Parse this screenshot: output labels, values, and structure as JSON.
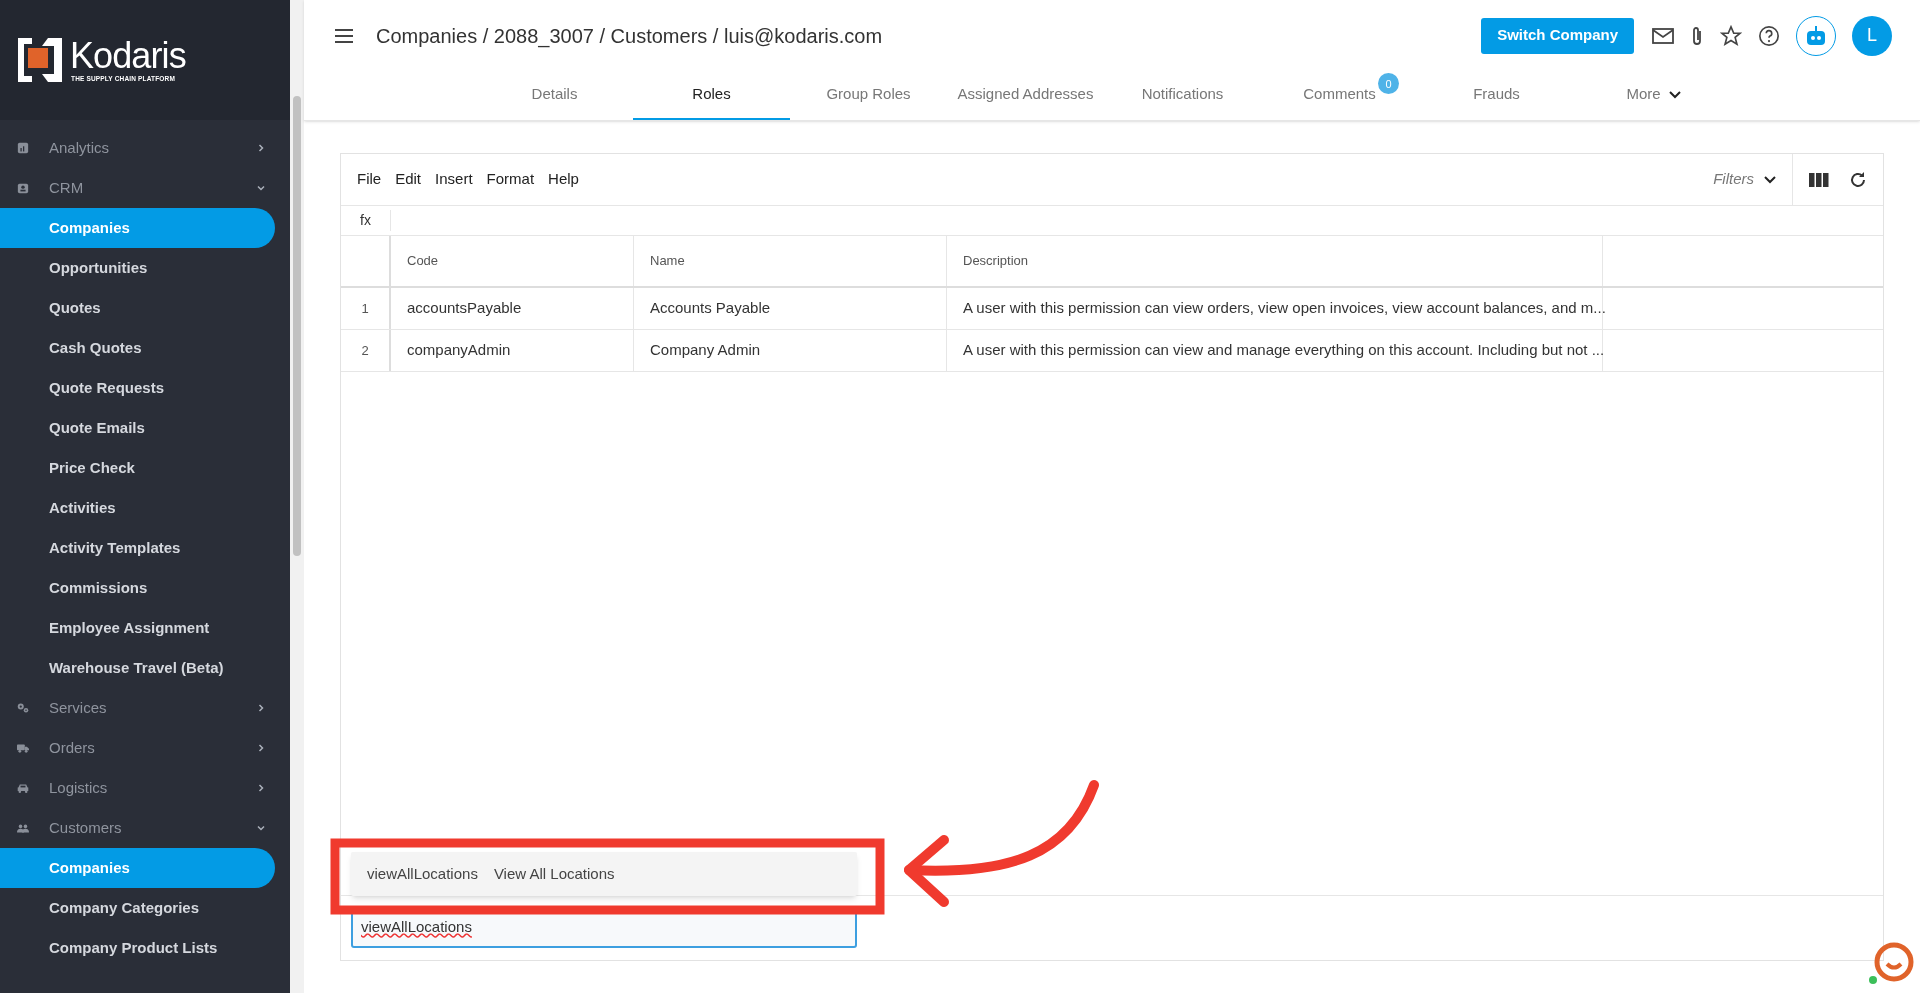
{
  "brand": {
    "name": "Kodaris",
    "tagline": "THE SUPPLY CHAIN PLATFORM"
  },
  "sidebar": {
    "items": [
      {
        "label": "Analytics",
        "expanded": false
      },
      {
        "label": "CRM",
        "expanded": true,
        "children": [
          {
            "label": "Companies",
            "selected": true
          },
          {
            "label": "Opportunities",
            "selected": false
          },
          {
            "label": "Quotes",
            "selected": false
          },
          {
            "label": "Cash Quotes",
            "selected": false
          },
          {
            "label": "Quote Requests",
            "selected": false
          },
          {
            "label": "Quote Emails",
            "selected": false
          },
          {
            "label": "Price Check",
            "selected": false
          },
          {
            "label": "Activities",
            "selected": false
          },
          {
            "label": "Activity Templates",
            "selected": false
          },
          {
            "label": "Commissions",
            "selected": false
          },
          {
            "label": "Employee Assignment",
            "selected": false
          },
          {
            "label": "Warehouse Travel (Beta)",
            "selected": false
          }
        ]
      },
      {
        "label": "Services",
        "expanded": false
      },
      {
        "label": "Orders",
        "expanded": false
      },
      {
        "label": "Logistics",
        "expanded": false
      },
      {
        "label": "Customers",
        "expanded": true,
        "children": [
          {
            "label": "Companies",
            "selected": true
          },
          {
            "label": "Company Categories",
            "selected": false
          },
          {
            "label": "Company Product Lists",
            "selected": false
          }
        ]
      }
    ]
  },
  "header": {
    "breadcrumb": "Companies / 2088_3007 / Customers / luis@kodaris.com",
    "switch_button": "Switch Company",
    "avatar": "L"
  },
  "tabs": [
    {
      "label": "Details",
      "selected": false
    },
    {
      "label": "Roles",
      "selected": true
    },
    {
      "label": "Group Roles",
      "selected": false
    },
    {
      "label": "Assigned Addresses",
      "selected": false
    },
    {
      "label": "Notifications",
      "selected": false
    },
    {
      "label": "Comments",
      "selected": false,
      "badge": "0"
    },
    {
      "label": "Frauds",
      "selected": false
    },
    {
      "label": "More",
      "selected": false,
      "kind": "menu"
    }
  ],
  "grid": {
    "menu": [
      "File",
      "Edit",
      "Insert",
      "Format",
      "Help"
    ],
    "filters": "Filters",
    "formula_label": "fx",
    "columns": [
      "Code",
      "Name",
      "Description"
    ],
    "rows": [
      {
        "number": "1",
        "cells": [
          "accountsPayable",
          "Accounts Payable",
          "A user with this permission can view orders, view open invoices, view account balances, and m..."
        ]
      },
      {
        "number": "2",
        "cells": [
          "companyAdmin",
          "Company Admin",
          "A user with this permission can view and manage everything on this account. Including but not ..."
        ]
      }
    ],
    "suggestion": {
      "code": "viewAllLocations",
      "name": "View All Locations"
    },
    "input": {
      "value": "viewAllLocations"
    }
  }
}
